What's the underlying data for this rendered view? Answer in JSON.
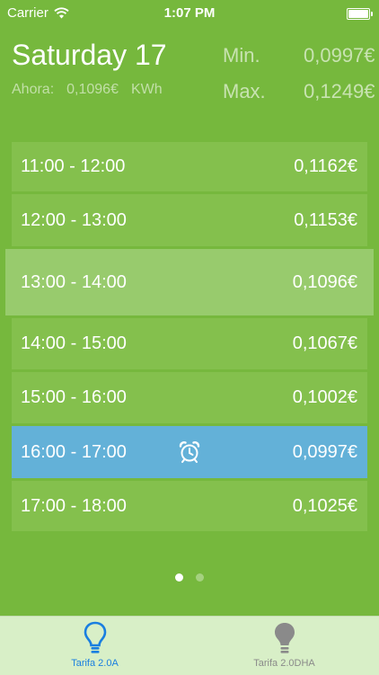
{
  "status_bar": {
    "carrier": "Carrier",
    "time": "1:07 PM"
  },
  "header": {
    "date_label": "Saturday 17",
    "now_label": "Ahora:",
    "now_price": "0,1096€",
    "now_unit": "KWh",
    "min_label": "Min.",
    "min_value": "0,0997€",
    "max_label": "Max.",
    "max_value": "0,1249€"
  },
  "hours": [
    {
      "range": "11:00 - 12:00",
      "price": "0,1162€"
    },
    {
      "range": "12:00 - 13:00",
      "price": "0,1153€"
    },
    {
      "range": "13:00 - 14:00",
      "price": "0,1096€"
    },
    {
      "range": "14:00 - 15:00",
      "price": "0,1067€"
    },
    {
      "range": "15:00 - 16:00",
      "price": "0,1002€"
    },
    {
      "range": "16:00 - 17:00",
      "price": "0,0997€"
    },
    {
      "range": "17:00 - 18:00",
      "price": "0,1025€"
    }
  ],
  "page_indicator": {
    "current": 1,
    "total": 2
  },
  "tabs": [
    {
      "label": "Tarifa 2.0A",
      "selected": true,
      "icon": "lightbulb-icon"
    },
    {
      "label": "Tarifa 2.0DHA",
      "selected": false,
      "icon": "lightbulb-icon"
    }
  ],
  "colors": {
    "background": "#76b83d",
    "row": "#84c04d",
    "row_current": "#98cb6d",
    "row_cheapest": "#63b1d8",
    "tab_selected": "#1a7fe0",
    "tab_unselected": "#8a8a8a"
  }
}
